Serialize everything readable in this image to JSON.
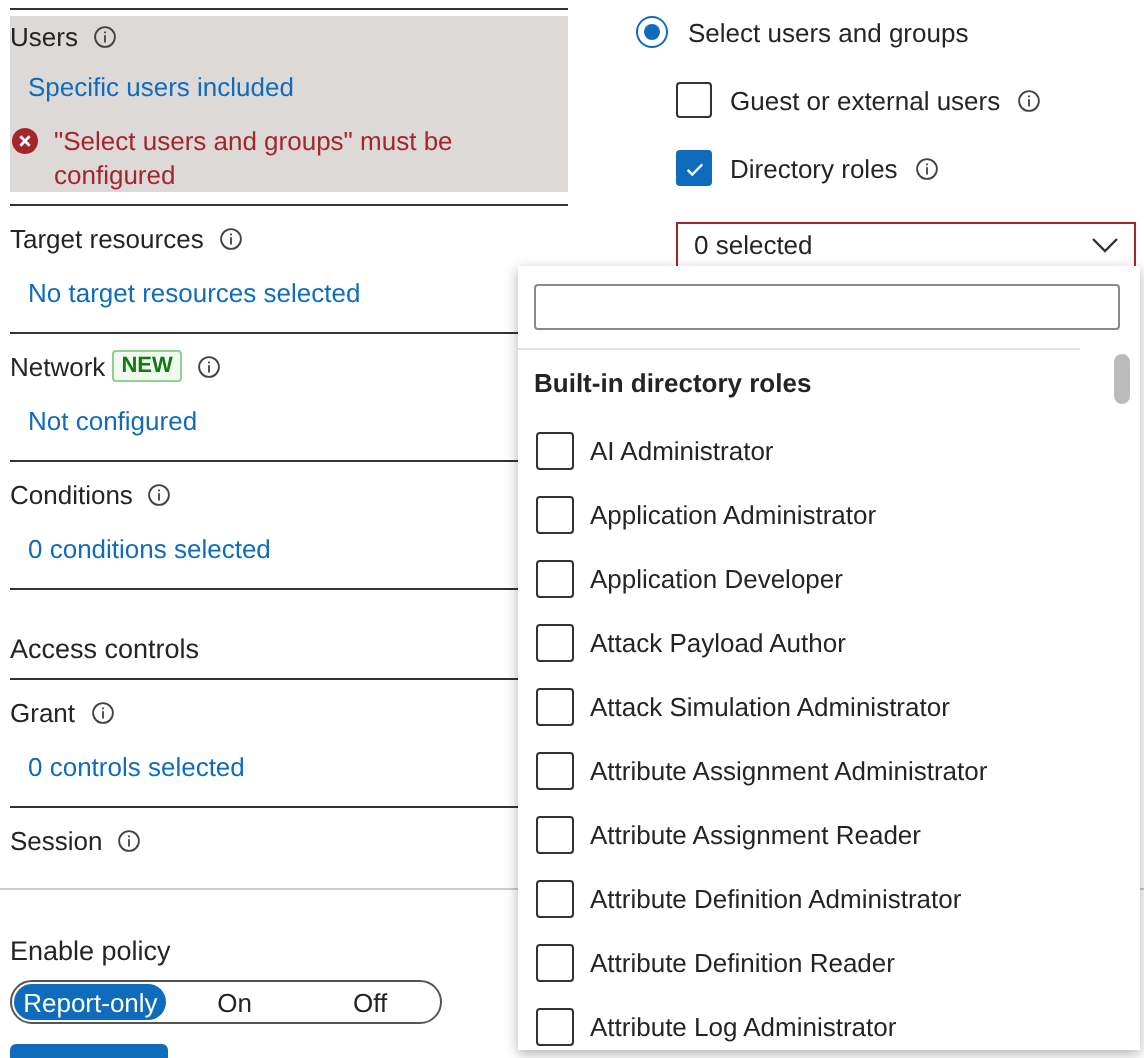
{
  "sections": [
    {
      "title": "Users",
      "info": true,
      "highlighted": true,
      "link": "Specific users included",
      "error": "\"Select users and groups\" must be configured"
    },
    {
      "title": "Target resources",
      "info": true,
      "link": "No target resources selected"
    },
    {
      "title": "Network",
      "badge": "NEW",
      "info": true,
      "link": "Not configured"
    },
    {
      "title": "Conditions",
      "info": true,
      "link": "0 conditions selected"
    }
  ],
  "access_controls": {
    "heading": "Access controls",
    "sections": [
      {
        "title": "Grant",
        "info": true,
        "link": "0 controls selected"
      },
      {
        "title": "Session",
        "info": true
      }
    ]
  },
  "footer": {
    "label": "Enable policy",
    "options": [
      {
        "label": "Report-only",
        "selected": true
      },
      {
        "label": "On",
        "selected": false
      },
      {
        "label": "Off",
        "selected": false
      }
    ]
  },
  "user_selection": {
    "radio": {
      "label": "Select users and groups",
      "selected": true
    },
    "options": [
      {
        "label": "Guest or external users",
        "checked": false,
        "info": true
      },
      {
        "label": "Directory roles",
        "checked": true,
        "info": true
      }
    ],
    "dropdown": {
      "value": "0 selected",
      "invalid": true
    }
  },
  "role_picker": {
    "heading": "Built-in directory roles",
    "roles": [
      {
        "label": "AI Administrator",
        "checked": false
      },
      {
        "label": "Application Administrator",
        "checked": false
      },
      {
        "label": "Application Developer",
        "checked": false
      },
      {
        "label": "Attack Payload Author",
        "checked": false
      },
      {
        "label": "Attack Simulation Administrator",
        "checked": false
      },
      {
        "label": "Attribute Assignment Administrator",
        "checked": false
      },
      {
        "label": "Attribute Assignment Reader",
        "checked": false
      },
      {
        "label": "Attribute Definition Administrator",
        "checked": false
      },
      {
        "label": "Attribute Definition Reader",
        "checked": false
      },
      {
        "label": "Attribute Log Administrator",
        "checked": false
      }
    ]
  }
}
